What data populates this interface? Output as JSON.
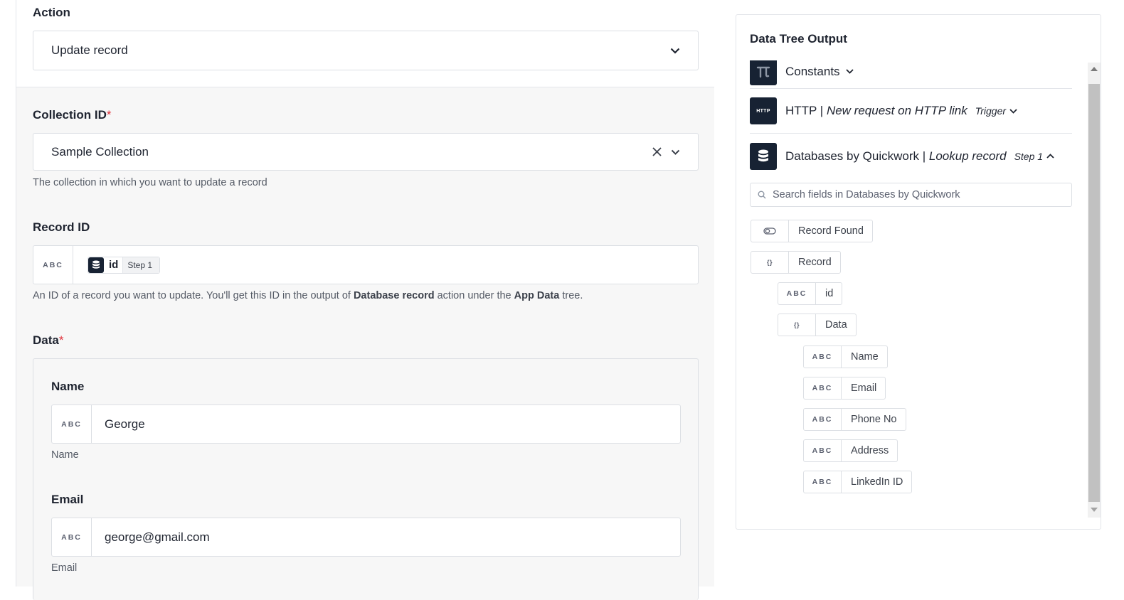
{
  "action": {
    "label": "Action",
    "value": "Update record"
  },
  "collection": {
    "label": "Collection ID",
    "required_mark": "*",
    "value": "Sample Collection",
    "help": "The collection in which you want to update a record"
  },
  "record_id": {
    "label": "Record ID",
    "type_badge": "ABC",
    "token_name": "id",
    "token_step": "Step 1",
    "help_prefix": "An ID of a record you want to update. You'll get this ID in the output of ",
    "help_bold1": "Database record",
    "help_mid": " action under the ",
    "help_bold2": "App Data",
    "help_suffix": " tree."
  },
  "data": {
    "label": "Data",
    "required_mark": "*",
    "fields": [
      {
        "label": "Name",
        "type_badge": "ABC",
        "value": "George",
        "help": "Name"
      },
      {
        "label": "Email",
        "type_badge": "ABC",
        "value": "george@gmail.com",
        "help": "Email"
      }
    ]
  },
  "tree": {
    "title": "Data Tree Output",
    "apps": [
      {
        "name": "Constants",
        "action": "",
        "tag": "",
        "icon": "pi-icon",
        "expanded": false
      },
      {
        "name": "HTTP | ",
        "action": "New request on HTTP link",
        "tag": "Trigger",
        "icon_text": "HTTP",
        "expanded": false
      },
      {
        "name": "Databases by Quickwork | ",
        "action": "Lookup record",
        "tag": "Step 1",
        "icon": "database-icon",
        "expanded": true
      }
    ],
    "search_placeholder": "Search fields in Databases by Quickwork",
    "nodes": [
      {
        "type": "toggle",
        "label": "Record Found"
      },
      {
        "type": "{}",
        "label": "Record"
      },
      {
        "type": "ABC",
        "label": "id"
      },
      {
        "type": "{}",
        "label": "Data"
      },
      {
        "type": "ABC",
        "label": "Name"
      },
      {
        "type": "ABC",
        "label": "Email"
      },
      {
        "type": "ABC",
        "label": "Phone No"
      },
      {
        "type": "ABC",
        "label": "Address"
      },
      {
        "type": "ABC",
        "label": "LinkedIn ID"
      }
    ]
  },
  "colors": {
    "icon_dark": "#172233",
    "required": "#e0323c",
    "border": "#dcdfe4",
    "form_bg": "#f7f7f7"
  }
}
